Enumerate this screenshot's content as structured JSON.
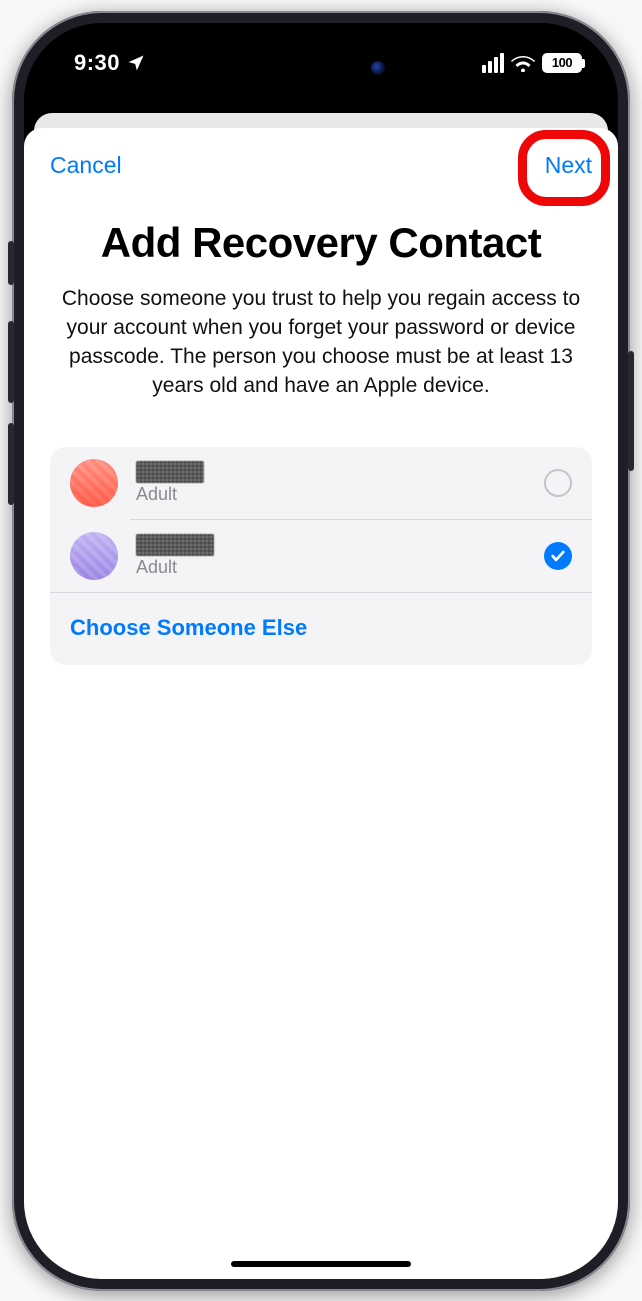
{
  "status": {
    "time": "9:30",
    "battery": "100"
  },
  "nav": {
    "cancel": "Cancel",
    "next": "Next"
  },
  "page": {
    "title": "Add Recovery Contact",
    "subtitle": "Choose someone you trust to help you regain access to your account when you forget your password or device passcode. The person you choose must be at least 13 years old and have an Apple device."
  },
  "contacts": [
    {
      "role": "Adult",
      "avatar_color": "red",
      "selected": false
    },
    {
      "role": "Adult",
      "avatar_color": "purple",
      "selected": true
    }
  ],
  "choose_else": "Choose Someone Else"
}
